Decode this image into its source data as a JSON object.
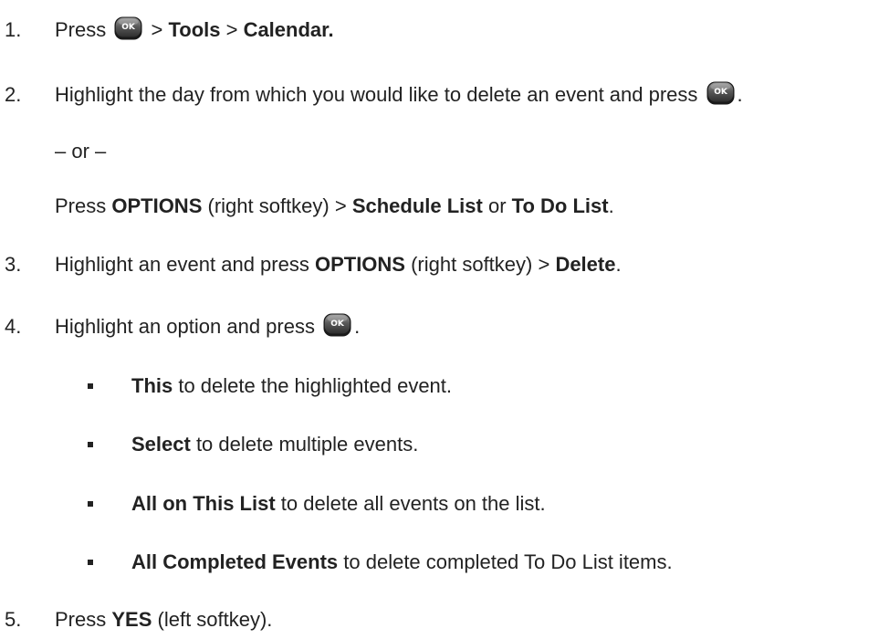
{
  "ok_icon_text": "OK",
  "steps": [
    {
      "number": "1.",
      "press": "Press",
      "sep1": " > ",
      "tools": "Tools",
      "sep2": " > ",
      "calendar": "Calendar."
    },
    {
      "number": "2.",
      "text": "Highlight the day from which you would like to delete an event and press",
      "end": ".",
      "or": "– or –",
      "alt_press": "Press ",
      "options": "OPTIONS",
      "alt_mid": " (right softkey) > ",
      "schedule_list": "Schedule List",
      "or_word": " or ",
      "todo_list": "To Do List",
      "alt_end": "."
    },
    {
      "number": "3.",
      "text": "Highlight an event and press ",
      "options": "OPTIONS",
      "mid": " (right softkey) > ",
      "delete": "Delete",
      "end": "."
    },
    {
      "number": "4.",
      "text": "Highlight an option and press",
      "end": ".",
      "bullets": [
        {
          "bold": "This",
          "text": " to delete the highlighted event."
        },
        {
          "bold": "Select",
          "text": " to delete multiple events."
        },
        {
          "bold": "All on This List",
          "text": " to delete all events on the list."
        },
        {
          "bold": "All Completed Events",
          "text": " to delete completed To Do List items."
        }
      ]
    },
    {
      "number": "5.",
      "text": "Press ",
      "yes": "YES",
      "end": " (left softkey)."
    }
  ]
}
